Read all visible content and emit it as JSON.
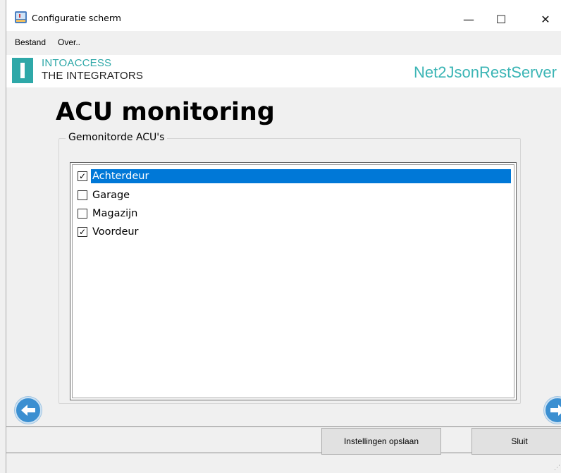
{
  "window": {
    "title": "Configuratie scherm",
    "minimize_glyph": "—",
    "maximize_glyph": "☐",
    "close_glyph": "✕"
  },
  "menu": {
    "items": [
      {
        "label": "Bestand"
      },
      {
        "label": "Over.."
      }
    ]
  },
  "banner": {
    "logo_top": "INTOACCESS",
    "logo_bottom": "THE INTEGRATORS",
    "product": "Net2JsonRestServer",
    "brand_color": "#2ea8a8"
  },
  "page": {
    "title": "ACU monitoring",
    "group_label": "Gemonitorde ACU's"
  },
  "acu_list": {
    "items": [
      {
        "label": "Achterdeur",
        "checked": true,
        "selected": true
      },
      {
        "label": "Garage",
        "checked": false,
        "selected": false
      },
      {
        "label": "Magazijn",
        "checked": false,
        "selected": false
      },
      {
        "label": "Voordeur",
        "checked": true,
        "selected": false
      }
    ],
    "selection_color": "#0078d7"
  },
  "navigation": {
    "back_icon": "arrow-left-icon",
    "next_icon": "arrow-right-icon"
  },
  "buttons": {
    "save_label": "Instellingen opslaan",
    "close_label": "Sluit"
  }
}
